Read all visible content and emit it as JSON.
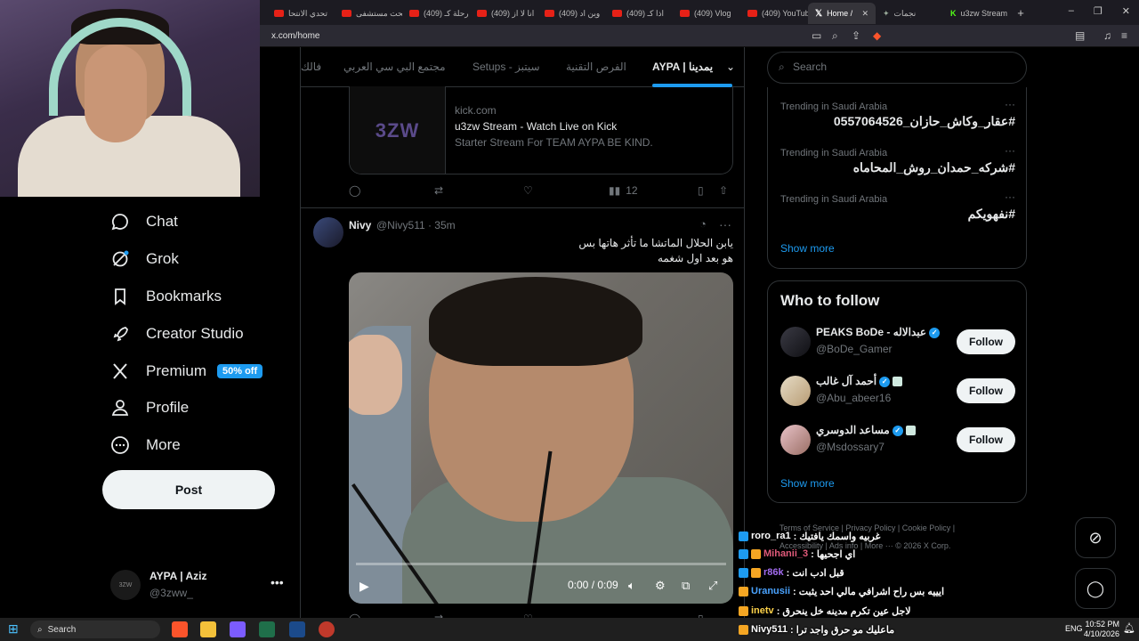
{
  "browser": {
    "tabs": [
      {
        "label": "تحدي الانتحا",
        "kind": "youtube"
      },
      {
        "label": "فتحت مستشفى",
        "kind": "youtube"
      },
      {
        "label": "(409) رحلة كـ",
        "kind": "youtube"
      },
      {
        "label": "(409) انا لا از",
        "kind": "youtube"
      },
      {
        "label": "(409) وين اد",
        "kind": "youtube"
      },
      {
        "label": "(409) اذا كـ",
        "kind": "youtube"
      },
      {
        "label": "(409) Vlog",
        "kind": "youtube"
      },
      {
        "label": "(409) YouTube",
        "kind": "youtube"
      },
      {
        "label": "Home /",
        "kind": "x",
        "active": true
      },
      {
        "label": "نجمات",
        "kind": "other"
      },
      {
        "label": "u3zw Stream",
        "kind": "kick"
      }
    ],
    "url": "x.com/home"
  },
  "nav": {
    "chat": "Chat",
    "grok": "Grok",
    "bookmarks": "Bookmarks",
    "creator_studio": "Creator Studio",
    "premium": "Premium",
    "premium_badge": "50% off",
    "profile": "Profile",
    "more": "More",
    "post": "Post"
  },
  "account": {
    "name": "AYPA | Aziz",
    "handle": "@3zww_",
    "avatar_text": "3ZW"
  },
  "top_tabs": [
    "AYPA | يمدينا",
    "الفرص التقنية",
    "Setups - سيتبز",
    "مجتمع البي سي العربي",
    "فالك"
  ],
  "card": {
    "thumb_text": "3ZW",
    "domain": "kick.com",
    "title": "u3zw Stream - Watch Live on Kick",
    "description": "Starter Stream For TEAM AYPA BE KIND."
  },
  "tweet1_actions": {
    "views": "12"
  },
  "tweet2": {
    "name": "Nivy",
    "handle": "@Nivy511 · 35m",
    "line1": "يابن الحلال الماتشا ما تأثر هاتها بس",
    "line2": "هو بعد اول شغمه",
    "video_time": "0:00 / 0:09"
  },
  "search": {
    "placeholder": "Search"
  },
  "trending": {
    "items": [
      {
        "context": "Trending in Saudi Arabia",
        "tag": "#عقار_وكاش_حازان_0557064526"
      },
      {
        "context": "Trending in Saudi Arabia",
        "tag": "#شركه_حمدان_روش_المحاماه"
      },
      {
        "context": "Trending in Saudi Arabia",
        "tag": "#نفهويكم"
      }
    ],
    "show_more": "Show more"
  },
  "who_to_follow": {
    "title": "Who to follow",
    "users": [
      {
        "name": "PEAKS BoDe - عبدالاله",
        "handle": "@BoDe_Gamer",
        "button": "Follow"
      },
      {
        "name": "أحمد آل غالب",
        "handle": "@Abu_abeer16",
        "button": "Follow"
      },
      {
        "name": "مساعد الدوسري",
        "handle": "@Msdossary7",
        "button": "Follow"
      }
    ],
    "show_more": "Show more"
  },
  "footer": {
    "line1": "Terms of Service  |  Privacy Policy  |  Cookie Policy  |",
    "line2": "Accessibility  |  Ads info  |  More ···  © 2026 X Corp."
  },
  "chat_overlay": [
    {
      "user": "roro_ra1",
      "text": ": غربيه واسمك يافتيك",
      "color": "#ffffff"
    },
    {
      "user": "Mihanii_3",
      "text": ": اي اجحيها",
      "color": "#e05a7a"
    },
    {
      "user": "r86k",
      "text": ": قبل ادب انت",
      "color": "#a36cf0"
    },
    {
      "user": "Uranusii",
      "text": ": ايييه بس راح اشرافي مالي احد يثبت",
      "color": "#4aa3ff"
    },
    {
      "user": "inetv",
      "text": ": لاجل عين تكرم مدينه خل ينحرق",
      "color": "#ffd34a"
    },
    {
      "user": "Nivy511",
      "text": ": ماعليك مو حرق واجد ترا",
      "color": "#ffffff"
    }
  ],
  "taskbar": {
    "search": "Search",
    "lang": "ENG",
    "time": "10:52 PM",
    "date": "4/10/2026"
  },
  "colors": {
    "accent": "#1d9bf0",
    "bg": "#000000",
    "border": "#2f3336",
    "muted": "#71767b"
  }
}
